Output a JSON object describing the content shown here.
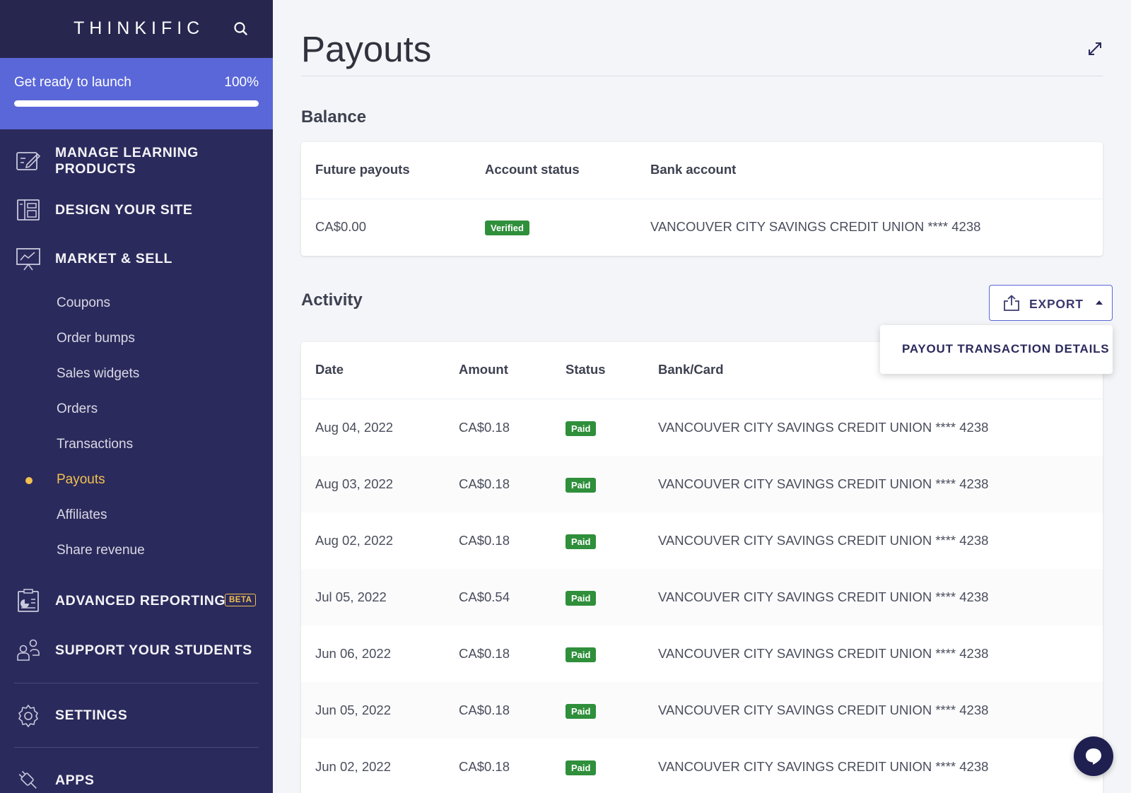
{
  "sidebar": {
    "brand": "THINKIFIC",
    "launch": {
      "label": "Get ready to launch",
      "percent_label": "100%",
      "progress": 1.0
    },
    "nav": [
      {
        "label": "MANAGE LEARNING PRODUCTS",
        "icon": "edit-board-icon"
      },
      {
        "label": "DESIGN YOUR SITE",
        "icon": "layout-icon"
      },
      {
        "label": "MARKET & SELL",
        "icon": "chart-presentation-icon"
      },
      {
        "label": "ADVANCED REPORTING",
        "icon": "report-icon",
        "badge": "BETA"
      },
      {
        "label": "SUPPORT YOUR STUDENTS",
        "icon": "people-icon"
      },
      {
        "label": "SETTINGS",
        "icon": "gear-icon"
      },
      {
        "label": "APPS",
        "icon": "plug-icon"
      }
    ],
    "market_sub": [
      "Coupons",
      "Order bumps",
      "Sales widgets",
      "Orders",
      "Transactions",
      "Payouts",
      "Affiliates",
      "Share revenue"
    ],
    "active_sub": "Payouts"
  },
  "page": {
    "title": "Payouts"
  },
  "balance": {
    "title": "Balance",
    "headers": [
      "Future payouts",
      "Account status",
      "Bank account"
    ],
    "future_payouts": "CA$0.00",
    "account_status": "Verified",
    "bank_account": "VANCOUVER CITY SAVINGS CREDIT UNION **** 4238"
  },
  "activity": {
    "title": "Activity",
    "export_label": "EXPORT",
    "dropdown_item": "PAYOUT TRANSACTION DETAILS",
    "headers": [
      "Date",
      "Amount",
      "Status",
      "Bank/Card"
    ],
    "rows": [
      {
        "date": "Aug 04, 2022",
        "amount": "CA$0.18",
        "status": "Paid",
        "bank": "VANCOUVER CITY SAVINGS CREDIT UNION **** 4238"
      },
      {
        "date": "Aug 03, 2022",
        "amount": "CA$0.18",
        "status": "Paid",
        "bank": "VANCOUVER CITY SAVINGS CREDIT UNION **** 4238"
      },
      {
        "date": "Aug 02, 2022",
        "amount": "CA$0.18",
        "status": "Paid",
        "bank": "VANCOUVER CITY SAVINGS CREDIT UNION **** 4238"
      },
      {
        "date": "Jul 05, 2022",
        "amount": "CA$0.54",
        "status": "Paid",
        "bank": "VANCOUVER CITY SAVINGS CREDIT UNION **** 4238"
      },
      {
        "date": "Jun 06, 2022",
        "amount": "CA$0.18",
        "status": "Paid",
        "bank": "VANCOUVER CITY SAVINGS CREDIT UNION **** 4238"
      },
      {
        "date": "Jun 05, 2022",
        "amount": "CA$0.18",
        "status": "Paid",
        "bank": "VANCOUVER CITY SAVINGS CREDIT UNION **** 4238"
      },
      {
        "date": "Jun 02, 2022",
        "amount": "CA$0.18",
        "status": "Paid",
        "bank": "VANCOUVER CITY SAVINGS CREDIT UNION **** 4238"
      }
    ]
  },
  "colors": {
    "sidebar": "#2b2a5c",
    "accent": "#5a67d8",
    "active": "#f2c14e",
    "paid": "#2f8f3b"
  }
}
